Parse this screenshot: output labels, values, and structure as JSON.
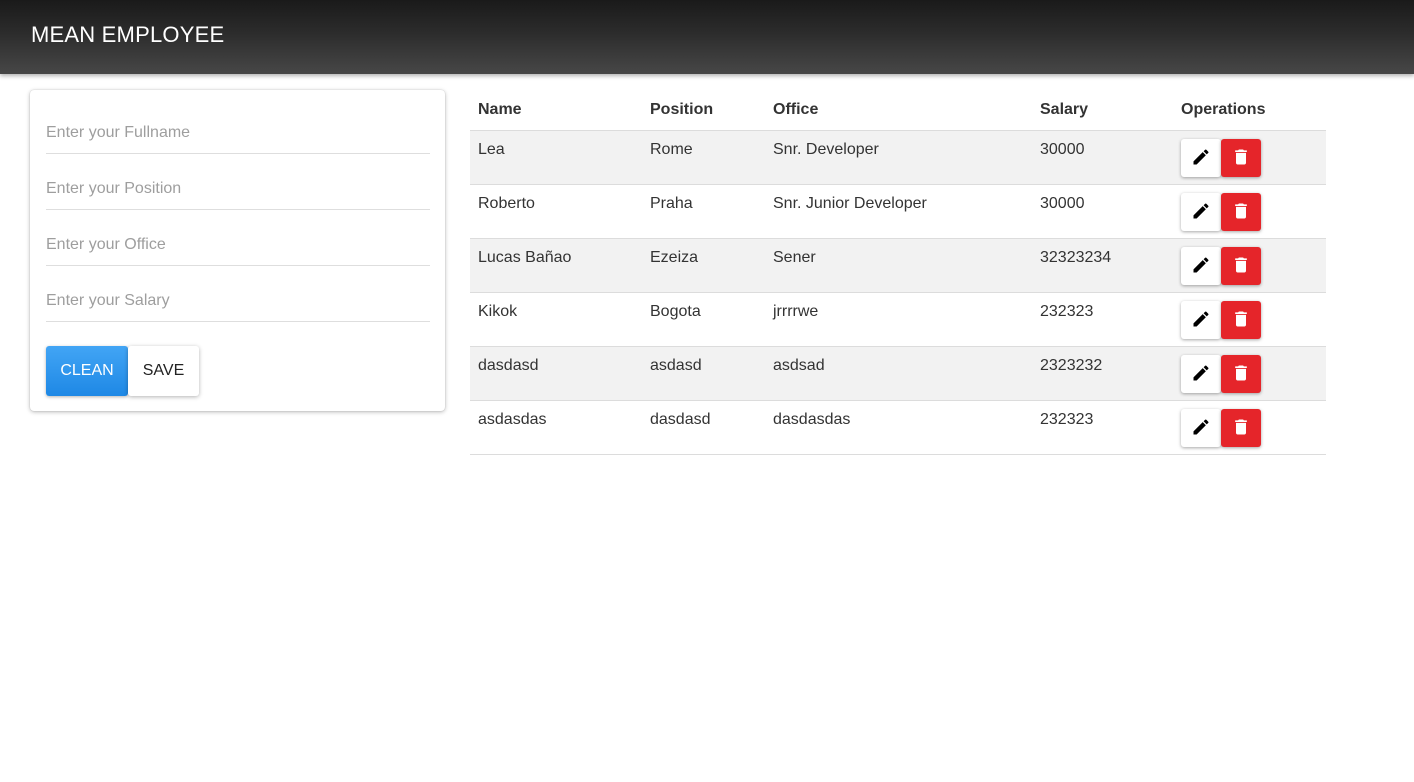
{
  "navbar": {
    "brand": "MEAN EMPLOYEE"
  },
  "form": {
    "fullname_placeholder": "Enter your Fullname",
    "position_placeholder": "Enter your Position",
    "office_placeholder": "Enter your Office",
    "salary_placeholder": "Enter your Salary",
    "clean_label": "CLEAN",
    "save_label": "SAVE"
  },
  "table": {
    "headers": [
      "Name",
      "Position",
      "Office",
      "Salary",
      "Operations"
    ],
    "rows": [
      {
        "name": "Lea",
        "position": "Rome",
        "office": "Snr. Developer",
        "salary": "30000"
      },
      {
        "name": "Roberto",
        "position": "Praha",
        "office": "Snr. Junior Developer",
        "salary": "30000"
      },
      {
        "name": "Lucas Bañao",
        "position": "Ezeiza",
        "office": "Sener",
        "salary": "32323234"
      },
      {
        "name": "Kikok",
        "position": "Bogota",
        "office": "jrrrrwe",
        "salary": "232323"
      },
      {
        "name": "dasdasd",
        "position": "asdasd",
        "office": "asdsad",
        "salary": "2323232"
      },
      {
        "name": "asdasdas",
        "position": "dasdasd",
        "office": "dasdasdas",
        "salary": "232323"
      }
    ],
    "edit_icon": "pencil-icon",
    "delete_icon": "trash-icon"
  },
  "colors": {
    "navbar": "#2c2c2c",
    "clean_button": "#2196f3",
    "delete_button": "#e5252a",
    "row_stripe": "#f2f2f2"
  }
}
